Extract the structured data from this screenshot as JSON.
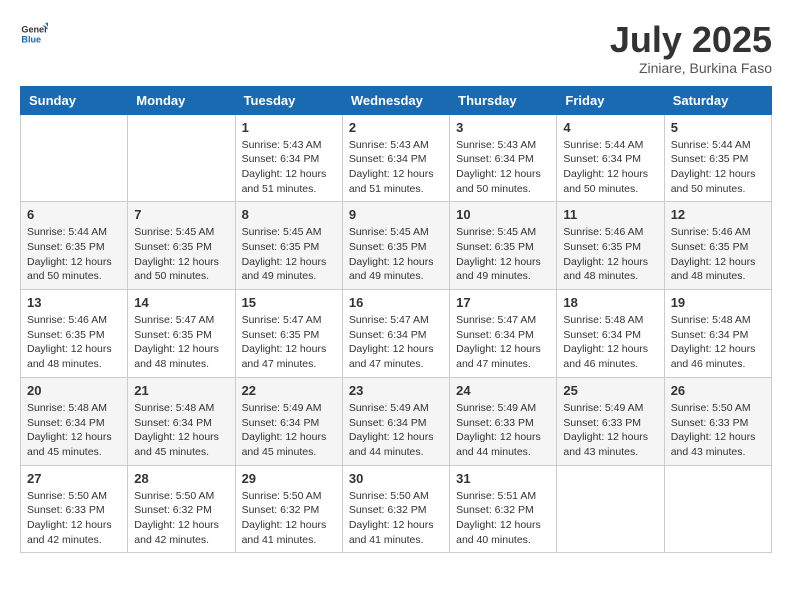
{
  "logo": {
    "text_general": "General",
    "text_blue": "Blue"
  },
  "header": {
    "month": "July 2025",
    "location": "Ziniare, Burkina Faso"
  },
  "days_of_week": [
    "Sunday",
    "Monday",
    "Tuesday",
    "Wednesday",
    "Thursday",
    "Friday",
    "Saturday"
  ],
  "weeks": [
    [
      {
        "day": "",
        "info": ""
      },
      {
        "day": "",
        "info": ""
      },
      {
        "day": "1",
        "info": "Sunrise: 5:43 AM\nSunset: 6:34 PM\nDaylight: 12 hours and 51 minutes."
      },
      {
        "day": "2",
        "info": "Sunrise: 5:43 AM\nSunset: 6:34 PM\nDaylight: 12 hours and 51 minutes."
      },
      {
        "day": "3",
        "info": "Sunrise: 5:43 AM\nSunset: 6:34 PM\nDaylight: 12 hours and 50 minutes."
      },
      {
        "day": "4",
        "info": "Sunrise: 5:44 AM\nSunset: 6:34 PM\nDaylight: 12 hours and 50 minutes."
      },
      {
        "day": "5",
        "info": "Sunrise: 5:44 AM\nSunset: 6:35 PM\nDaylight: 12 hours and 50 minutes."
      }
    ],
    [
      {
        "day": "6",
        "info": "Sunrise: 5:44 AM\nSunset: 6:35 PM\nDaylight: 12 hours and 50 minutes."
      },
      {
        "day": "7",
        "info": "Sunrise: 5:45 AM\nSunset: 6:35 PM\nDaylight: 12 hours and 50 minutes."
      },
      {
        "day": "8",
        "info": "Sunrise: 5:45 AM\nSunset: 6:35 PM\nDaylight: 12 hours and 49 minutes."
      },
      {
        "day": "9",
        "info": "Sunrise: 5:45 AM\nSunset: 6:35 PM\nDaylight: 12 hours and 49 minutes."
      },
      {
        "day": "10",
        "info": "Sunrise: 5:45 AM\nSunset: 6:35 PM\nDaylight: 12 hours and 49 minutes."
      },
      {
        "day": "11",
        "info": "Sunrise: 5:46 AM\nSunset: 6:35 PM\nDaylight: 12 hours and 48 minutes."
      },
      {
        "day": "12",
        "info": "Sunrise: 5:46 AM\nSunset: 6:35 PM\nDaylight: 12 hours and 48 minutes."
      }
    ],
    [
      {
        "day": "13",
        "info": "Sunrise: 5:46 AM\nSunset: 6:35 PM\nDaylight: 12 hours and 48 minutes."
      },
      {
        "day": "14",
        "info": "Sunrise: 5:47 AM\nSunset: 6:35 PM\nDaylight: 12 hours and 48 minutes."
      },
      {
        "day": "15",
        "info": "Sunrise: 5:47 AM\nSunset: 6:35 PM\nDaylight: 12 hours and 47 minutes."
      },
      {
        "day": "16",
        "info": "Sunrise: 5:47 AM\nSunset: 6:34 PM\nDaylight: 12 hours and 47 minutes."
      },
      {
        "day": "17",
        "info": "Sunrise: 5:47 AM\nSunset: 6:34 PM\nDaylight: 12 hours and 47 minutes."
      },
      {
        "day": "18",
        "info": "Sunrise: 5:48 AM\nSunset: 6:34 PM\nDaylight: 12 hours and 46 minutes."
      },
      {
        "day": "19",
        "info": "Sunrise: 5:48 AM\nSunset: 6:34 PM\nDaylight: 12 hours and 46 minutes."
      }
    ],
    [
      {
        "day": "20",
        "info": "Sunrise: 5:48 AM\nSunset: 6:34 PM\nDaylight: 12 hours and 45 minutes."
      },
      {
        "day": "21",
        "info": "Sunrise: 5:48 AM\nSunset: 6:34 PM\nDaylight: 12 hours and 45 minutes."
      },
      {
        "day": "22",
        "info": "Sunrise: 5:49 AM\nSunset: 6:34 PM\nDaylight: 12 hours and 45 minutes."
      },
      {
        "day": "23",
        "info": "Sunrise: 5:49 AM\nSunset: 6:34 PM\nDaylight: 12 hours and 44 minutes."
      },
      {
        "day": "24",
        "info": "Sunrise: 5:49 AM\nSunset: 6:33 PM\nDaylight: 12 hours and 44 minutes."
      },
      {
        "day": "25",
        "info": "Sunrise: 5:49 AM\nSunset: 6:33 PM\nDaylight: 12 hours and 43 minutes."
      },
      {
        "day": "26",
        "info": "Sunrise: 5:50 AM\nSunset: 6:33 PM\nDaylight: 12 hours and 43 minutes."
      }
    ],
    [
      {
        "day": "27",
        "info": "Sunrise: 5:50 AM\nSunset: 6:33 PM\nDaylight: 12 hours and 42 minutes."
      },
      {
        "day": "28",
        "info": "Sunrise: 5:50 AM\nSunset: 6:32 PM\nDaylight: 12 hours and 42 minutes."
      },
      {
        "day": "29",
        "info": "Sunrise: 5:50 AM\nSunset: 6:32 PM\nDaylight: 12 hours and 41 minutes."
      },
      {
        "day": "30",
        "info": "Sunrise: 5:50 AM\nSunset: 6:32 PM\nDaylight: 12 hours and 41 minutes."
      },
      {
        "day": "31",
        "info": "Sunrise: 5:51 AM\nSunset: 6:32 PM\nDaylight: 12 hours and 40 minutes."
      },
      {
        "day": "",
        "info": ""
      },
      {
        "day": "",
        "info": ""
      }
    ]
  ]
}
